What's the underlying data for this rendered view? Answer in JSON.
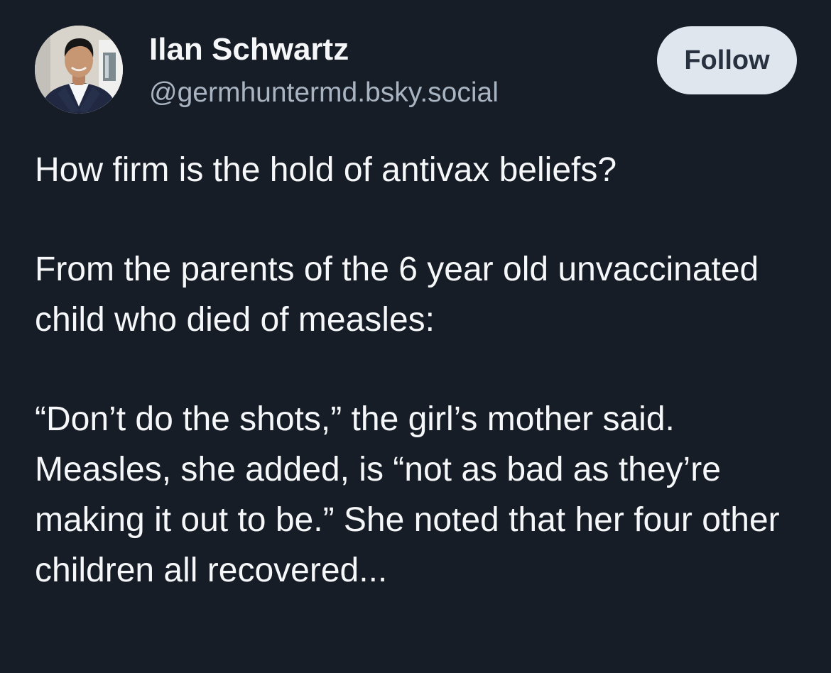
{
  "author": {
    "display_name": "Ilan Schwartz",
    "handle": "@germhuntermd.bsky.social",
    "avatar_icon": "profile-photo"
  },
  "actions": {
    "follow_label": "Follow"
  },
  "post": {
    "paragraphs": [
      "How firm is the hold of antivax beliefs?",
      "From the parents of the 6 year old unvaccinated child who died of measles:",
      "“Don’t do the shots,” the girl’s mother said. Measles, she added, is “not as bad as they’re making it out to be.” She noted that her four other children all recovered..."
    ]
  },
  "colors": {
    "background": "#171d27",
    "text_primary": "#f5f7f9",
    "text_secondary": "#a9b4c2",
    "button_bg": "#dfe6ee",
    "button_text": "#27313f"
  }
}
